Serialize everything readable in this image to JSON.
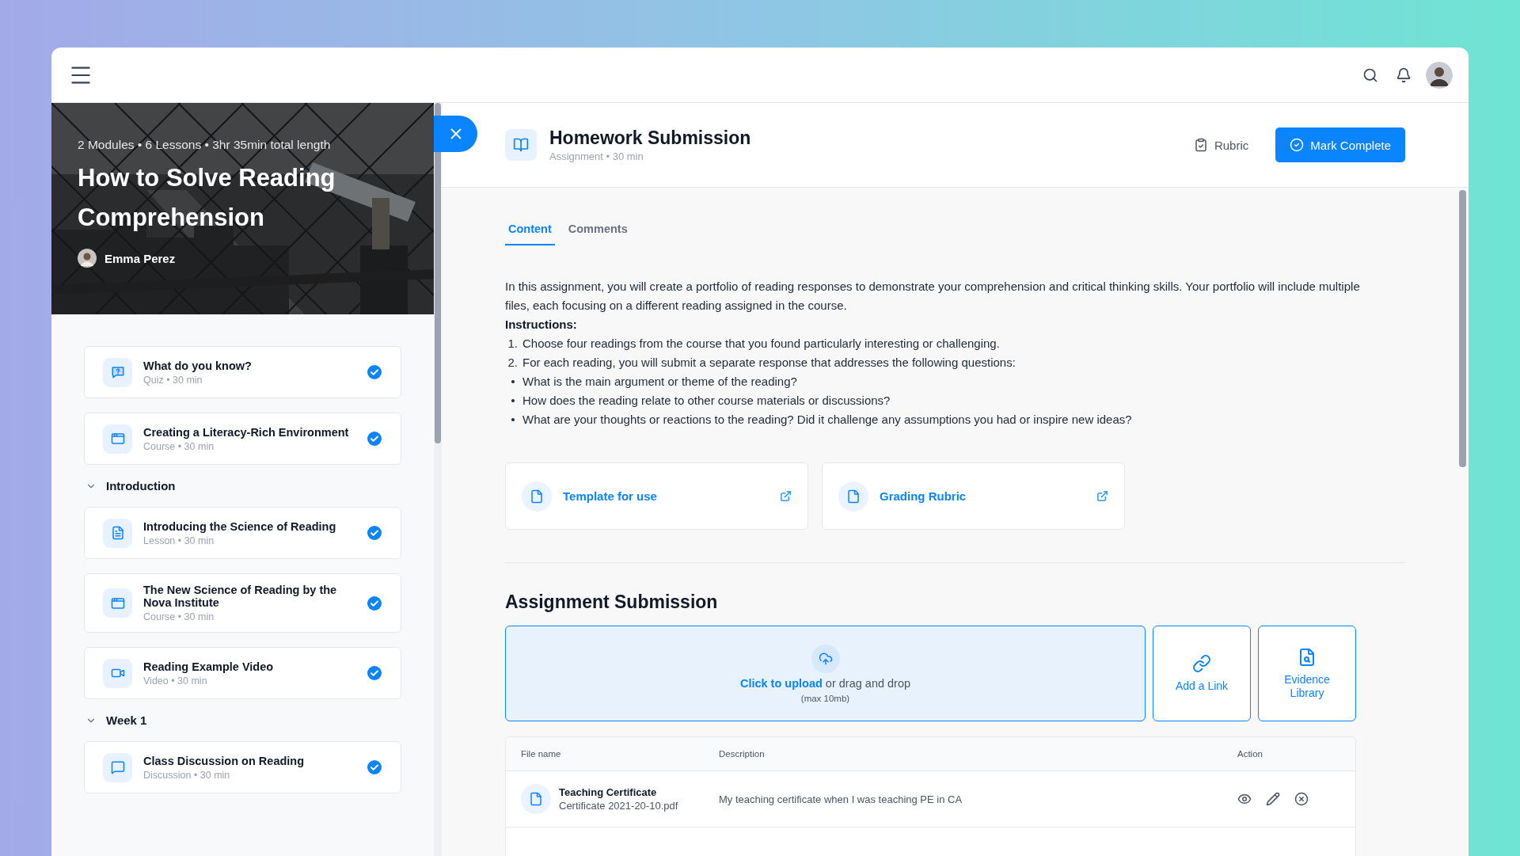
{
  "course": {
    "meta": "2 Modules • 6 Lessons • 3hr 35min total length",
    "title": "How to Solve Reading Comprehension",
    "author": "Emma Perez"
  },
  "outline": [
    {
      "kind": "quiz",
      "title": "What do you know?",
      "meta": "Quiz • 30 min",
      "done": true
    },
    {
      "kind": "course",
      "title": "Creating a Literacy-Rich Environment",
      "meta": "Course • 30 min",
      "done": true
    },
    {
      "kind": "section",
      "title": "Introduction",
      "expanded": true,
      "children": [
        {
          "kind": "lesson",
          "title": "Introducing the Science of Reading",
          "meta": "Lesson • 30 min",
          "done": true
        },
        {
          "kind": "course",
          "title": "The New Science of Reading by the Nova Institute",
          "meta": "Course • 30 min",
          "done": true
        },
        {
          "kind": "video",
          "title": "Reading Example Video",
          "meta": "Video • 30 min",
          "done": true
        }
      ]
    },
    {
      "kind": "section",
      "title": "Week 1",
      "expanded": true,
      "children": [
        {
          "kind": "discussion",
          "title": "Class Discussion on Reading",
          "meta": "Discussion • 30 min",
          "done": true
        }
      ]
    }
  ],
  "lesson": {
    "title": "Homework Submission",
    "meta": "Assignment • 30 min",
    "rubric": "Rubric",
    "complete": "Mark Complete"
  },
  "tabs": [
    {
      "label": "Content",
      "selected": true
    },
    {
      "label": "Comments",
      "selected": false
    }
  ],
  "body": {
    "intro": "In this assignment, you will create a portfolio of reading responses to demonstrate your comprehension and critical thinking skills. Your portfolio will include multiple files, each focusing on a different reading assigned in the course.",
    "instructions_label": "Instructions:",
    "steps": [
      {
        "number": "1.",
        "text": "Choose four readings from the course that you found particularly interesting or challenging."
      },
      {
        "number": "2.",
        "text": "For each reading, you will submit a separate response that addresses the following questions:"
      }
    ],
    "bullets": [
      "What is the main argument or theme of the reading?",
      "How does the reading relate to other course materials or discussions?",
      "What are your thoughts or reactions to the reading? Did it challenge any assumptions you had or inspire new ideas?"
    ]
  },
  "resources": [
    {
      "label": "Template for use"
    },
    {
      "label": "Grading Rubric"
    }
  ],
  "submission": {
    "heading": "Assignment Submission",
    "upload_link": "Click to upload",
    "upload_text": "or drag and drop",
    "limit": "(max 10mb)",
    "options": [
      {
        "kind": "link",
        "label": "Add a Link"
      },
      {
        "kind": "library",
        "label": "Evidence Library"
      }
    ]
  },
  "table": {
    "columns": [
      "File name",
      "Description",
      "Action"
    ],
    "rows": [
      {
        "name": "Teaching Certificate",
        "file": "Certificate 2021-20-10.pdf",
        "description": "My teaching certificate when I was teaching PE in CA"
      }
    ]
  }
}
